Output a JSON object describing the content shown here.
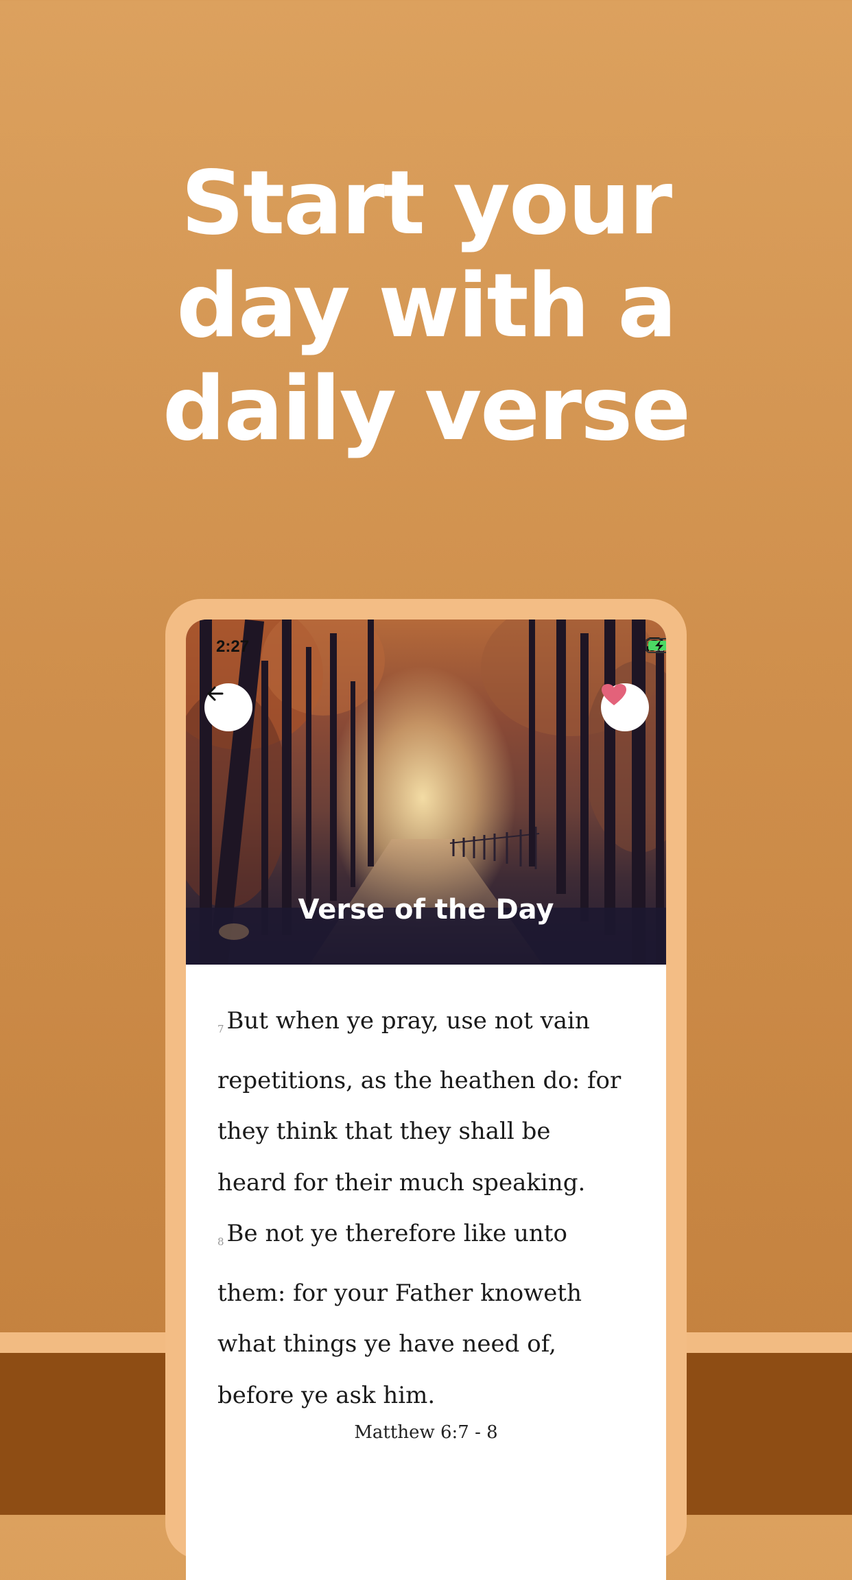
{
  "headline": {
    "line1": "Start your",
    "line2": "day with a",
    "line3": "daily verse"
  },
  "status_bar": {
    "time": "2:27"
  },
  "header": {
    "title": "Verse of the Day",
    "back_icon": "arrow-left-icon",
    "favorite_icon": "heart-icon"
  },
  "verse": {
    "number1": "7",
    "lines1": [
      "But when ye pray, use not vain",
      "repetitions, as the heathen do: for",
      "they think that they shall be",
      "heard for their much speaking."
    ],
    "number2": "8",
    "lines2": [
      "Be not ye therefore like unto",
      "them: for your Father knoweth",
      "what things ye have need of,",
      "before ye ask him."
    ],
    "reference": "Matthew 6:7 - 8"
  },
  "colors": {
    "background_top": "#dca15e",
    "background_bottom": "#c27f3c",
    "frame": "#f3bd85",
    "floor": "#8e4d14",
    "heart": "#e3627a",
    "battery": "#4cd964"
  }
}
